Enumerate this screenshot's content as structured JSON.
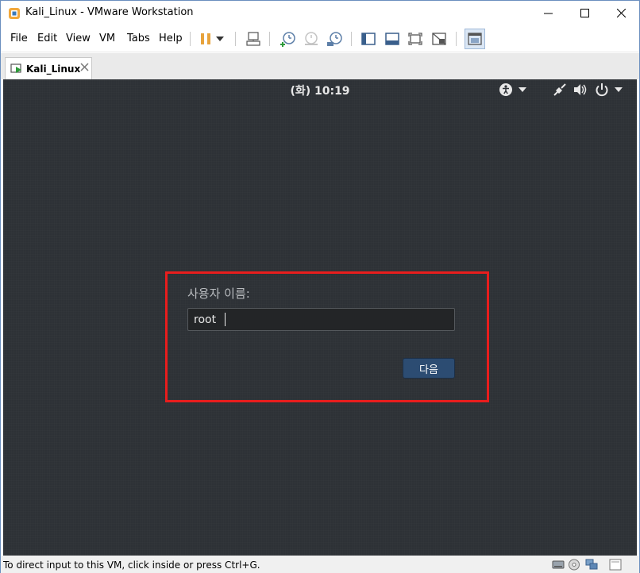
{
  "window": {
    "title": "Kali_Linux - VMware Workstation"
  },
  "menubar": {
    "items": [
      "File",
      "Edit",
      "View",
      "VM",
      "Tabs",
      "Help"
    ]
  },
  "toolbar": {
    "icons": [
      "pause-icon",
      "dropdown-icon",
      "send-ctrl-alt-del-icon",
      "snapshot-take-icon",
      "snapshot-revert-icon",
      "snapshot-manager-icon",
      "show-library-icon",
      "thumbnail-bar-icon",
      "full-screen-icon",
      "unity-icon",
      "console-view-icon"
    ],
    "accent": "#e8a33c"
  },
  "tabs": [
    {
      "label": "Kali_Linux",
      "active": true
    }
  ],
  "guest": {
    "clock": "(화) 10:19",
    "login": {
      "username_label": "사용자 이름:",
      "username_value": "root",
      "next_label": "다음",
      "highlight_color": "#e81d1d"
    },
    "topbar_icons": [
      "accessibility-icon",
      "network-icon",
      "volume-icon",
      "power-icon"
    ]
  },
  "statusbar": {
    "text": "To direct input to this VM, click inside or press Ctrl+G."
  }
}
